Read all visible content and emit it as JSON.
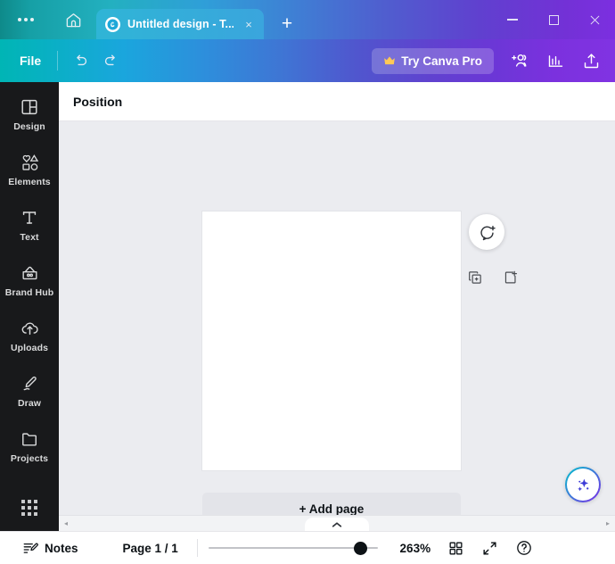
{
  "window": {
    "tab_title": "Untitled design - T...",
    "favicon": "canva-logo-icon",
    "dots_menu": "overflow-menu-icon",
    "home": "home-icon",
    "new_tab": "+",
    "close_tab": "×",
    "minimize": "minimize-icon",
    "maximize": "maximize-icon",
    "close": "close-icon"
  },
  "toolbar": {
    "file_label": "File",
    "undo": "undo-icon",
    "redo": "redo-icon",
    "pro_label": "Try Canva Pro",
    "pro_crown": "👑",
    "share_people": "add-collaborator-icon",
    "analytics": "analytics-icon",
    "upload_share": "share-upload-icon"
  },
  "sidebar": {
    "items": [
      {
        "label": "Design",
        "icon": "design-icon"
      },
      {
        "label": "Elements",
        "icon": "elements-icon"
      },
      {
        "label": "Text",
        "icon": "text-icon"
      },
      {
        "label": "Brand Hub",
        "icon": "brand-hub-icon"
      },
      {
        "label": "Uploads",
        "icon": "uploads-icon"
      },
      {
        "label": "Draw",
        "icon": "draw-icon"
      },
      {
        "label": "Projects",
        "icon": "projects-icon"
      }
    ],
    "apps_label": "apps-grid-icon"
  },
  "panel": {
    "position_label": "Position"
  },
  "canvas": {
    "duplicate_page": "duplicate-page-icon",
    "add_page_icon": "add-page-icon",
    "comment": "add-comment-icon",
    "add_page_label": "+ Add page",
    "magic": "magic-studio-icon"
  },
  "statusbar": {
    "notes_label": "Notes",
    "notes_icon": "notes-icon",
    "page_label": "Page 1 / 1",
    "zoom_level": "263%",
    "grid_view": "grid-view-icon",
    "fullscreen": "fullscreen-icon",
    "help": "help-icon"
  },
  "scrollbar": {
    "left_arrow": "◂",
    "right_arrow": "▸",
    "collapse": "chevron-up-icon"
  },
  "colors": {
    "brand_teal": "#00c4cc",
    "brand_purple": "#7d2ae8",
    "sidebar_bg": "#18191b",
    "canvas_bg": "#ebecf0",
    "text_dark": "#0d1216"
  }
}
